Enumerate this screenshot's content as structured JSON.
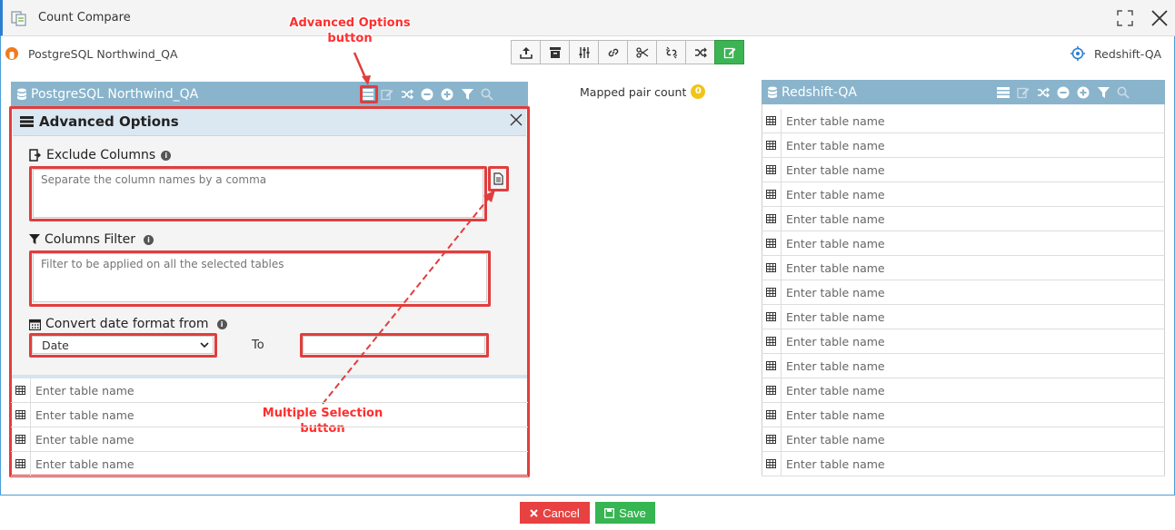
{
  "window": {
    "title": "Count Compare"
  },
  "source": {
    "connection_name": "PostgreSQL Northwind_QA"
  },
  "target": {
    "connection_name": "Redshift-QA"
  },
  "mapped": {
    "label": "Mapped pair count",
    "count": "0"
  },
  "advanced_options": {
    "title": "Advanced Options",
    "exclude_columns_label": "Exclude Columns",
    "exclude_columns_placeholder": "Separate the column names by a comma",
    "columns_filter_label": "Columns Filter",
    "columns_filter_placeholder": "Filter to be applied on all the selected tables",
    "convert_date_label": "Convert date format from",
    "date_from_value": "Date",
    "to_label": "To",
    "date_to_value": ""
  },
  "table_placeholder": "Enter table name",
  "left_rows": [
    "",
    "",
    "",
    ""
  ],
  "right_rows": [
    "",
    "",
    "",
    "",
    "",
    "",
    "",
    "",
    "",
    "",
    "",
    "",
    "",
    "",
    ""
  ],
  "annotations": {
    "advanced_line1": "Advanced Options",
    "advanced_line2": "button",
    "multiple_line1": "Multiple Selection",
    "multiple_line2": "button"
  },
  "footer": {
    "cancel_label": "Cancel",
    "save_label": "Save"
  },
  "colors": {
    "panel_header": "#8ab4cc",
    "accent_blue": "#2b7fd0",
    "annotation_red": "#e23d3d",
    "save_green": "#36b552",
    "cancel_red": "#e84141",
    "badge_yellow": "#f0c419"
  }
}
